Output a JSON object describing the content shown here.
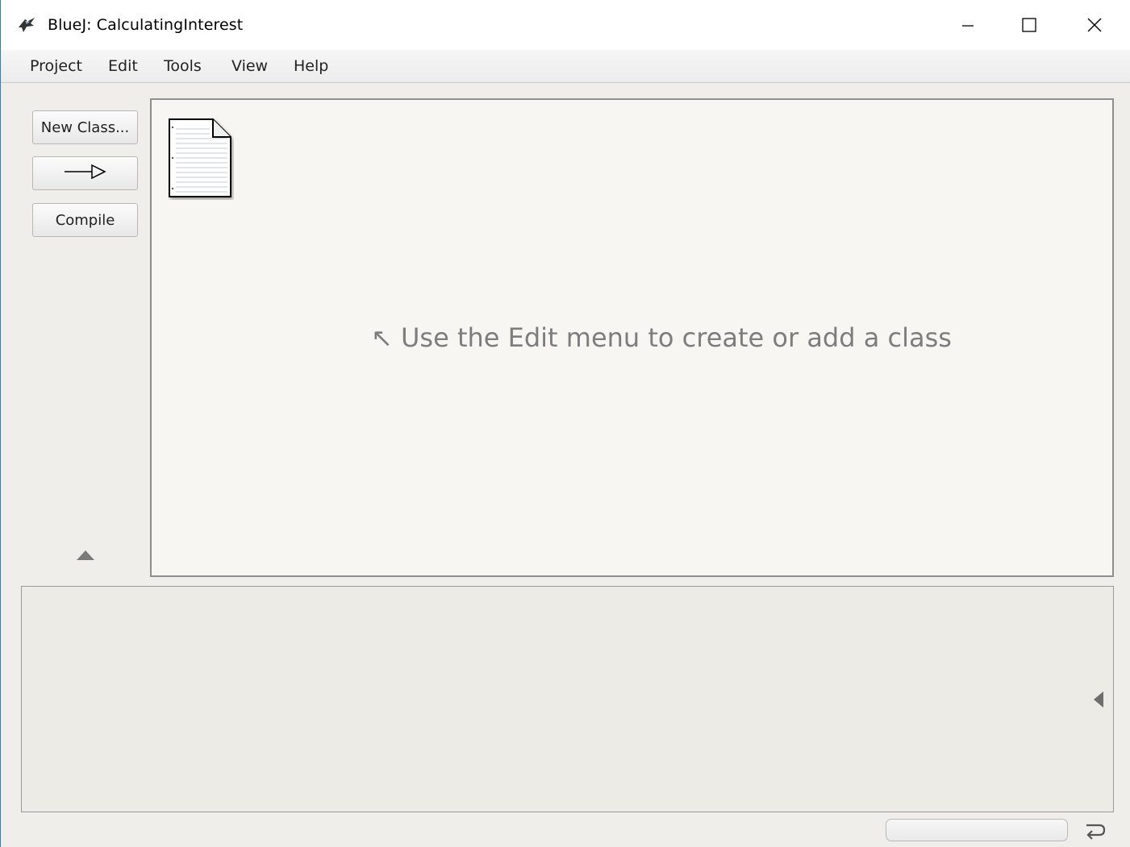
{
  "window": {
    "title": "BlueJ:  CalculatingInterest",
    "controls": [
      "minimize-icon",
      "maximize-icon",
      "close-icon"
    ]
  },
  "menubar": {
    "items": [
      {
        "label": "Project"
      },
      {
        "label": "Edit"
      },
      {
        "label": "Tools"
      },
      {
        "label": "View"
      },
      {
        "label": "Help"
      }
    ]
  },
  "toolbar": {
    "new_class_label": "New Class...",
    "inheritance_icon": "inheritance-arrow-icon",
    "compile_label": "Compile"
  },
  "diagram": {
    "readme_icon": "readme-document-icon",
    "hint": "↖ Use the Edit menu to create or add a class"
  },
  "colors": {
    "window_border": "#2b7bd6",
    "diagram_background": "#f7f6f2",
    "hint_text": "#7d7d7d"
  }
}
